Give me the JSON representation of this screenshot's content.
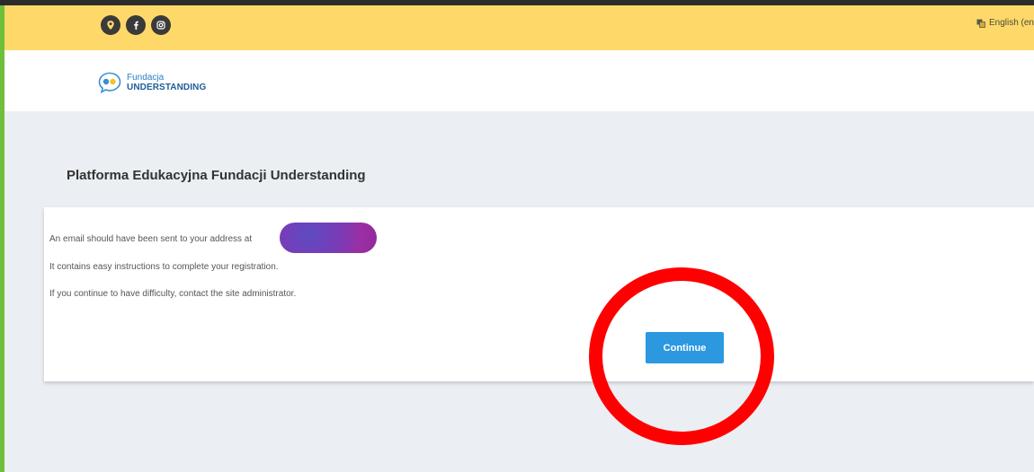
{
  "social_bar": {
    "icons": [
      "location-icon",
      "facebook-icon",
      "instagram-icon"
    ],
    "language_label": "English (en"
  },
  "logo": {
    "line1": "Fundacja",
    "line2": "UNDERSTANDING"
  },
  "page": {
    "title": "Platforma Edukacyjna Fundacji Understanding"
  },
  "message": {
    "line1": "An email should have been sent to your address at",
    "line2": "It contains easy instructions to complete your registration.",
    "line3": "If you continue to have difficulty, contact the site administrator."
  },
  "actions": {
    "continue_label": "Continue"
  },
  "colors": {
    "social_bar": "#fed96a",
    "content_bg": "#ebeef3",
    "button": "#2b98e0",
    "annotation": "#ff0000"
  }
}
